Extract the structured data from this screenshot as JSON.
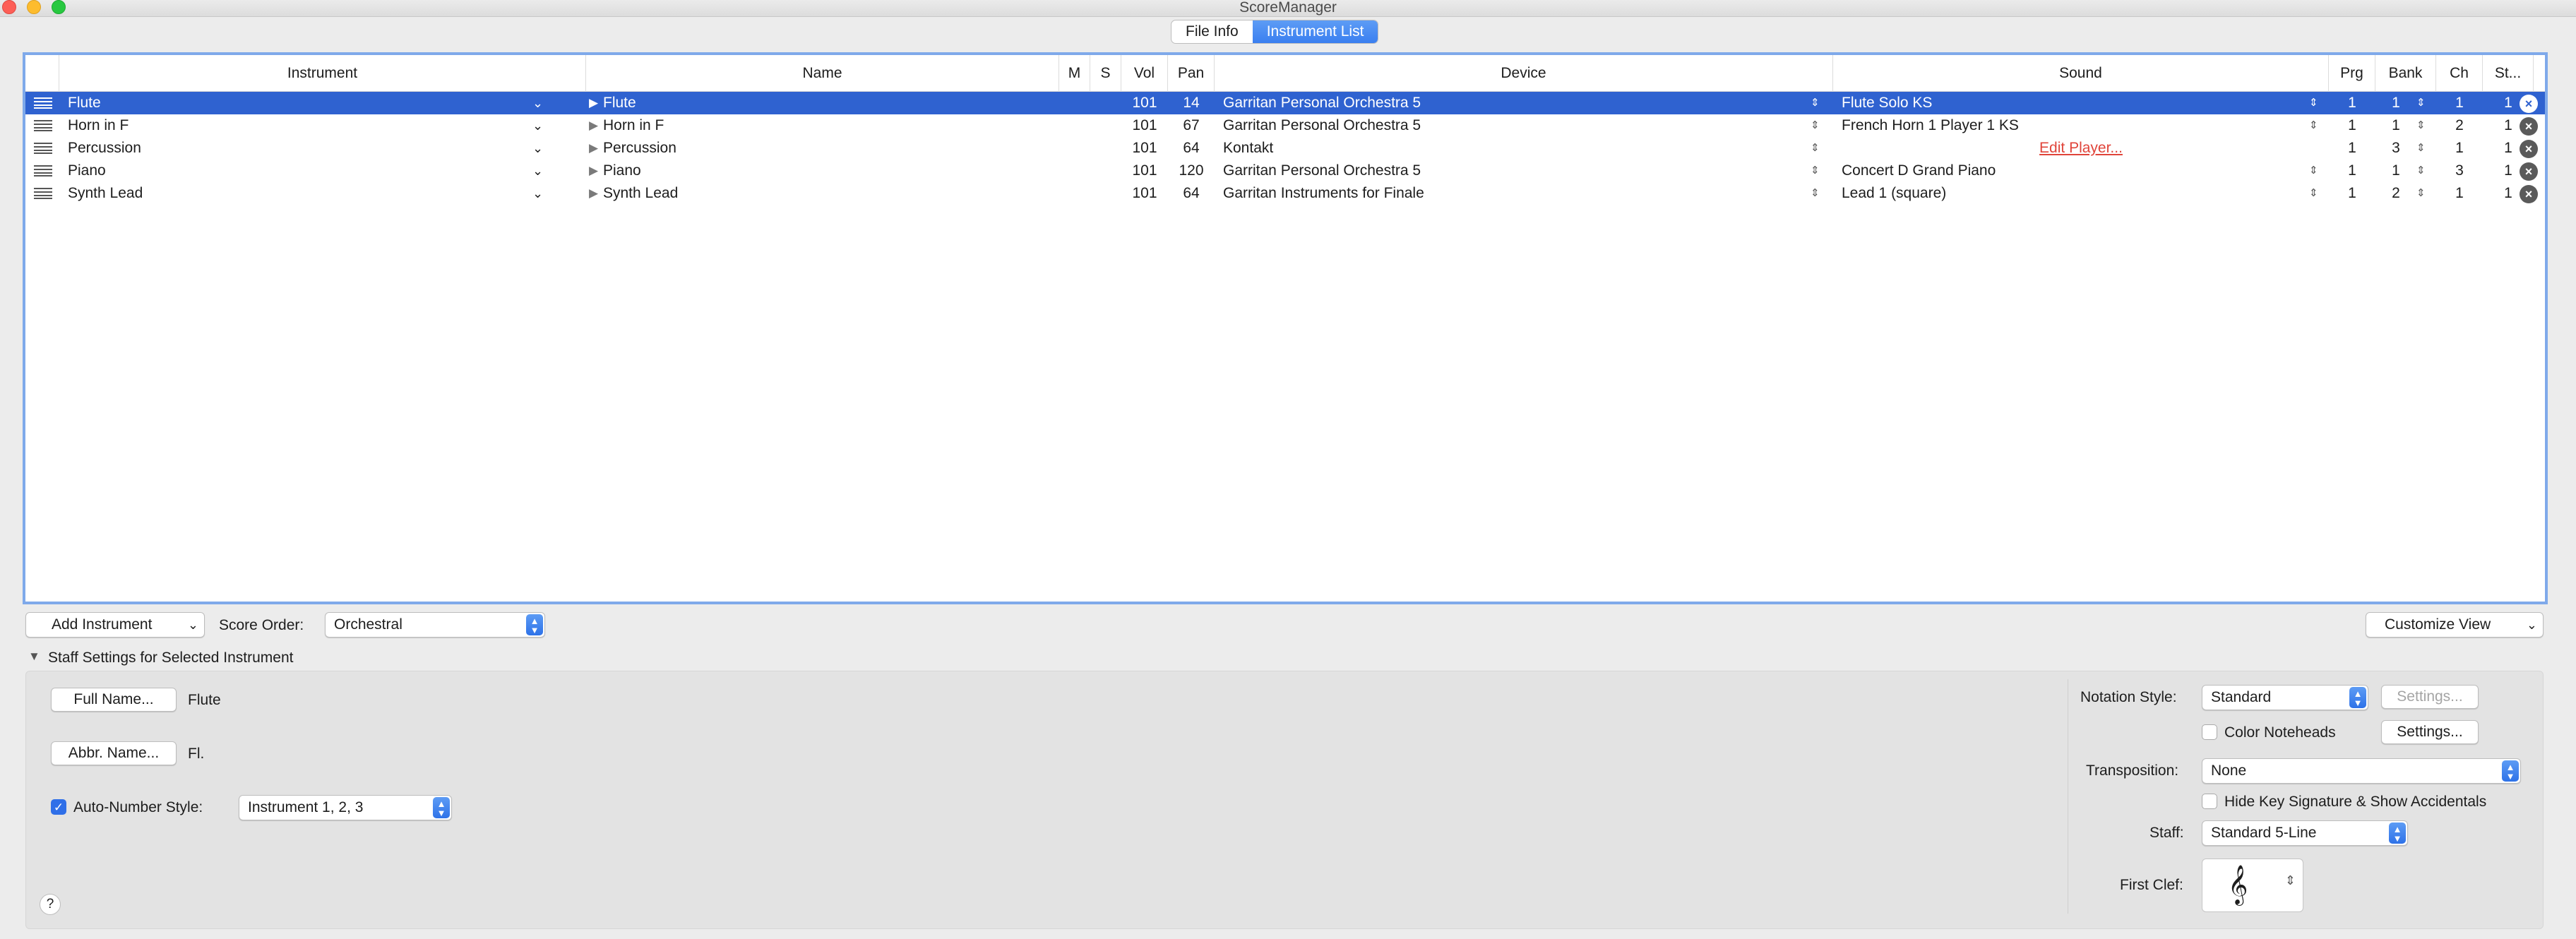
{
  "window": {
    "title": "ScoreManager"
  },
  "tabs": [
    {
      "label": "File Info",
      "active": false
    },
    {
      "label": "Instrument List",
      "active": true
    }
  ],
  "table": {
    "columns": {
      "instrument": "Instrument",
      "name": "Name",
      "m": "M",
      "s": "S",
      "vol": "Vol",
      "pan": "Pan",
      "device": "Device",
      "sound": "Sound",
      "prg": "Prg",
      "bank": "Bank",
      "ch": "Ch",
      "st": "St..."
    },
    "rows": [
      {
        "instrument": "Flute",
        "name": "Flute",
        "vol": "101",
        "pan": "14",
        "device": "Garritan Personal Orchestra 5",
        "sound": "Flute Solo KS",
        "prg": "1",
        "bank": "1",
        "ch": "1",
        "st": "1",
        "selected": true
      },
      {
        "instrument": "Horn in F",
        "name": "Horn in F",
        "vol": "101",
        "pan": "67",
        "device": "Garritan Personal Orchestra 5",
        "sound": "French Horn 1 Player 1 KS",
        "prg": "1",
        "bank": "1",
        "ch": "2",
        "st": "1",
        "selected": false
      },
      {
        "instrument": "Percussion",
        "name": "Percussion",
        "vol": "101",
        "pan": "64",
        "device": "Kontakt",
        "sound": "Edit Player...",
        "prg": "1",
        "bank": "3",
        "ch": "1",
        "st": "1",
        "selected": false
      },
      {
        "instrument": "Piano",
        "name": "Piano",
        "vol": "101",
        "pan": "120",
        "device": "Garritan Personal Orchestra 5",
        "sound": "Concert D Grand Piano",
        "prg": "1",
        "bank": "1",
        "ch": "3",
        "st": "1",
        "selected": false
      },
      {
        "instrument": "Synth Lead",
        "name": "Synth Lead",
        "vol": "101",
        "pan": "64",
        "device": "Garritan Instruments for Finale",
        "sound": "Lead 1 (square)",
        "prg": "1",
        "bank": "2",
        "ch": "1",
        "st": "1",
        "selected": false
      }
    ]
  },
  "toolbar": {
    "add_instrument": "Add Instrument",
    "score_order_label": "Score Order:",
    "score_order_value": "Orchestral",
    "customize_view": "Customize View"
  },
  "staff_settings": {
    "header": "Staff Settings for Selected Instrument",
    "full_name_button": "Full Name...",
    "full_name_value": "Flute",
    "abbr_name_button": "Abbr. Name...",
    "abbr_name_value": "Fl.",
    "auto_number_label": "Auto-Number Style:",
    "auto_number_value": "Instrument 1, 2, 3",
    "notation_style_label": "Notation Style:",
    "notation_style_value": "Standard",
    "settings_disabled": "Settings...",
    "color_noteheads_label": "Color Noteheads",
    "settings_button": "Settings...",
    "transposition_label": "Transposition:",
    "transposition_value": "None",
    "hide_key_label": "Hide Key Signature & Show Accidentals",
    "staff_label": "Staff:",
    "staff_value": "Standard 5-Line",
    "first_clef_label": "First Clef:",
    "help": "?"
  },
  "colors": {
    "selection": "#2f62d0",
    "accent": "#3a7ff0",
    "table_border": "#7fa9ea",
    "link": "#e0443a"
  }
}
